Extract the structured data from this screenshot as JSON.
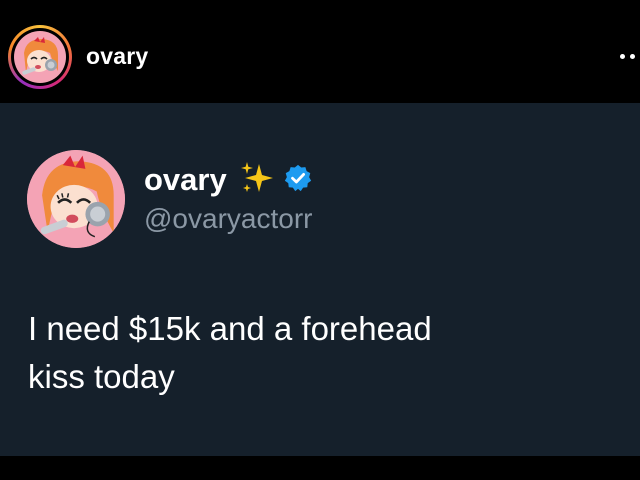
{
  "post_header": {
    "username": "ovary",
    "avatar_icon": "cartoon-girl-avatar-icon",
    "more_icon": "more-options-icon"
  },
  "tweet": {
    "display_name": "ovary",
    "sparkles_icon": "sparkles-icon",
    "verified_icon": "verified-badge-icon",
    "handle": "@ovaryactorr",
    "text_line1": "I need $15k and a forehead",
    "text_line2": "kiss today"
  },
  "colors": {
    "background": "#000000",
    "card_background": "#15202b",
    "text": "#ffffff",
    "handle": "#8b98a5",
    "verified": "#1d9bf0",
    "sparkles": "#f5c518"
  }
}
